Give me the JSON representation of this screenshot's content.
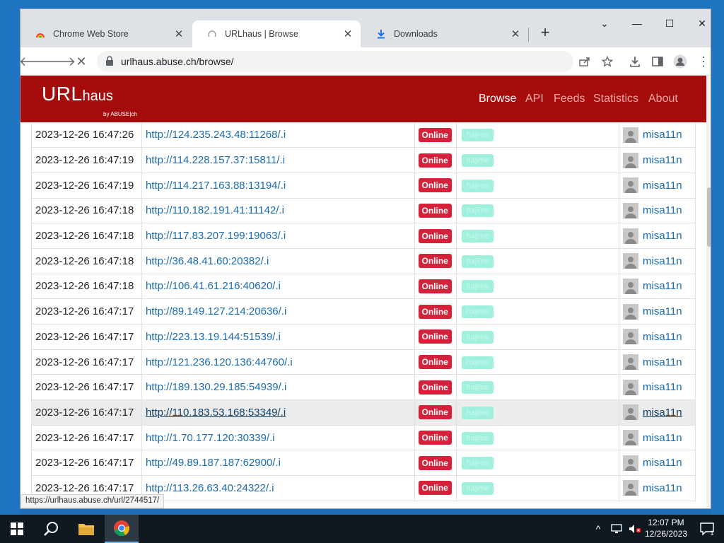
{
  "browser": {
    "tabs": [
      {
        "title": "Chrome Web Store",
        "active": false
      },
      {
        "title": "URLhaus | Browse",
        "active": true
      },
      {
        "title": "Downloads",
        "active": false
      }
    ],
    "address": "urlhaus.abuse.ch/browse/",
    "status_url": "https://urlhaus.abuse.ch/url/2744517/"
  },
  "site": {
    "logo_main": "URL",
    "logo_sub": "haus",
    "logo_by": "by ABUSE|ch",
    "nav": [
      "Browse",
      "API",
      "Feeds",
      "Statistics",
      "About"
    ],
    "active_nav": "Browse"
  },
  "rows": [
    {
      "date": "2023-12-26 16:47:26",
      "url": "http://124.235.243.48:11268/.i",
      "status": "Online",
      "tag": "hajime",
      "reporter": "misa11n"
    },
    {
      "date": "2023-12-26 16:47:19",
      "url": "http://114.228.157.37:15811/.i",
      "status": "Online",
      "tag": "hajime",
      "reporter": "misa11n"
    },
    {
      "date": "2023-12-26 16:47:19",
      "url": "http://114.217.163.88:13194/.i",
      "status": "Online",
      "tag": "hajime",
      "reporter": "misa11n"
    },
    {
      "date": "2023-12-26 16:47:18",
      "url": "http://110.182.191.41:11142/.i",
      "status": "Online",
      "tag": "hajime",
      "reporter": "misa11n"
    },
    {
      "date": "2023-12-26 16:47:18",
      "url": "http://117.83.207.199:19063/.i",
      "status": "Online",
      "tag": "hajime",
      "reporter": "misa11n"
    },
    {
      "date": "2023-12-26 16:47:18",
      "url": "http://36.48.41.60:20382/.i",
      "status": "Online",
      "tag": "hajime",
      "reporter": "misa11n"
    },
    {
      "date": "2023-12-26 16:47:18",
      "url": "http://106.41.61.216:40620/.i",
      "status": "Online",
      "tag": "hajime",
      "reporter": "misa11n"
    },
    {
      "date": "2023-12-26 16:47:17",
      "url": "http://89.149.127.214:20636/.i",
      "status": "Online",
      "tag": "hajime",
      "reporter": "misa11n"
    },
    {
      "date": "2023-12-26 16:47:17",
      "url": "http://223.13.19.144:51539/.i",
      "status": "Online",
      "tag": "hajime",
      "reporter": "misa11n"
    },
    {
      "date": "2023-12-26 16:47:17",
      "url": "http://121.236.120.136:44760/.i",
      "status": "Online",
      "tag": "hajime",
      "reporter": "misa11n"
    },
    {
      "date": "2023-12-26 16:47:17",
      "url": "http://189.130.29.185:54939/.i",
      "status": "Online",
      "tag": "hajime",
      "reporter": "misa11n"
    },
    {
      "date": "2023-12-26 16:47:17",
      "url": "http://110.183.53.168:53349/.i",
      "status": "Online",
      "tag": "hajime",
      "reporter": "misa11n"
    },
    {
      "date": "2023-12-26 16:47:17",
      "url": "http://1.70.177.120:30339/.i",
      "status": "Online",
      "tag": "hajime",
      "reporter": "misa11n"
    },
    {
      "date": "2023-12-26 16:47:17",
      "url": "http://49.89.187.187:62900/.i",
      "status": "Online",
      "tag": "hajime",
      "reporter": "misa11n"
    },
    {
      "date": "2023-12-26 16:47:17",
      "url": "http://113.26.63.40:24322/.i",
      "status": "Online",
      "tag": "hajime",
      "reporter": "misa11n"
    }
  ],
  "hover_row": 11,
  "taskbar": {
    "time": "12:07 PM",
    "date": "12/26/2023",
    "notifications": "1"
  },
  "colors": {
    "header": "#a50d0d",
    "link": "#1a6bb0",
    "badge_online": "#d3223a",
    "tag_hajime": "#9ff0dd"
  }
}
